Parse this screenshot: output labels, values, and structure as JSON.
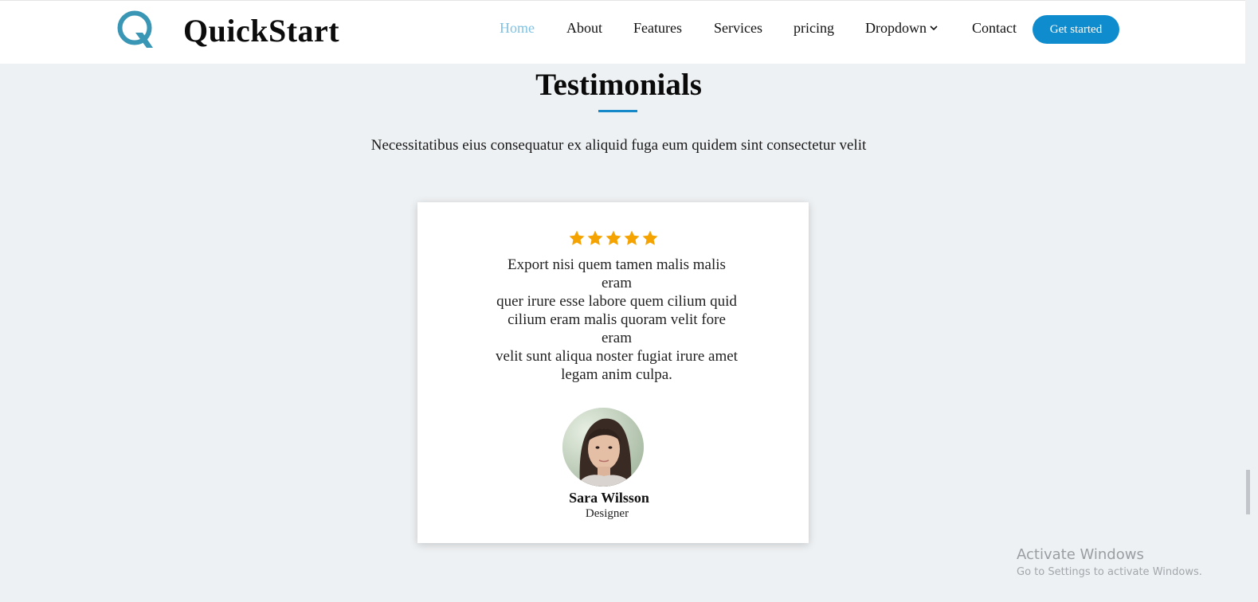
{
  "brand": {
    "name": "QuickStart",
    "accent_color": "#1589c9",
    "logo_icon": "q-logo-icon"
  },
  "nav": {
    "items": [
      "Home",
      "About",
      "Features",
      "Services",
      "pricing",
      "Dropdown",
      "Contact"
    ],
    "active": "Home",
    "cta_label": "Get started",
    "dropdown_icon": "chevron-down-icon"
  },
  "section": {
    "title": "Testimonials",
    "subtitle": "Necessitatibus eius consequatur ex aliquid fuga eum quidem sint consectetur velit"
  },
  "testimonial": {
    "rating": 5,
    "rating_max": 5,
    "star_color": "#f4a300",
    "quote_lines": [
      "Export nisi quem tamen malis malis",
      "eram",
      "quer irure esse labore quem cilium quid",
      "cilium eram malis quoram velit fore",
      "eram",
      "velit sunt aliqua noster fugiat irure amet",
      "legam anim culpa."
    ],
    "name": "Sara Wilsson",
    "role": "Designer"
  },
  "watermark": {
    "title": "Activate Windows",
    "subtitle": "Go to Settings to activate Windows."
  }
}
